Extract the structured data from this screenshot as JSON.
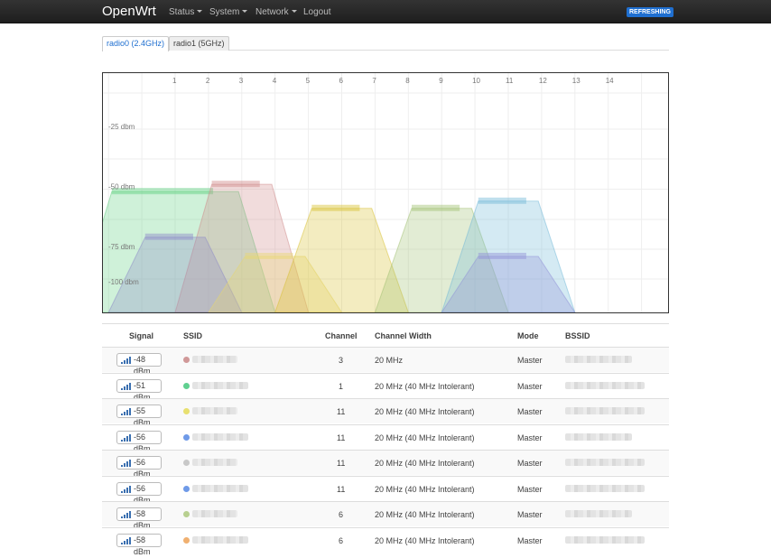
{
  "navbar": {
    "brand": "OpenWrt",
    "menu": [
      {
        "label": "Status",
        "dropdown": true
      },
      {
        "label": "System",
        "dropdown": true
      },
      {
        "label": "Network",
        "dropdown": true
      },
      {
        "label": "Logout",
        "dropdown": false
      }
    ],
    "refresh_badge": "REFRESHING"
  },
  "tabs": [
    {
      "label": "radio0 (2.4GHz)",
      "active": true
    },
    {
      "label": "radio1 (5GHz)",
      "active": false
    }
  ],
  "channel_chart": {
    "channels": [
      "1",
      "2",
      "3",
      "4",
      "5",
      "6",
      "7",
      "8",
      "9",
      "10",
      "11",
      "12",
      "13",
      "14"
    ],
    "dbm_labels": [
      "-25 dbm",
      "-50 dbm",
      "-75 dbm",
      "-100 dbm"
    ],
    "networks": [
      {
        "channel": 1,
        "width_mhz": 40,
        "signal": -51,
        "color": "#60d080"
      },
      {
        "channel": 3,
        "width_mhz": 20,
        "signal": -48,
        "color": "#d08a8a"
      },
      {
        "channel": 1,
        "width_mhz": 20,
        "signal": -70,
        "color": "#8c88c8"
      },
      {
        "channel": 4,
        "width_mhz": 20,
        "signal": -78,
        "color": "#e8d870"
      },
      {
        "channel": 6,
        "width_mhz": 20,
        "signal": -58,
        "color": "#d8c030"
      },
      {
        "channel": 9,
        "width_mhz": 20,
        "signal": -58,
        "color": "#a0c070"
      },
      {
        "channel": 11,
        "width_mhz": 20,
        "signal": -55,
        "color": "#70b8d8"
      },
      {
        "channel": 11,
        "width_mhz": 20,
        "signal": -78,
        "color": "#9090d8"
      }
    ]
  },
  "table": {
    "headers": {
      "signal": "Signal",
      "ssid": "SSID",
      "channel": "Channel",
      "width": "Channel Width",
      "mode": "Mode",
      "bssid": "BSSID"
    },
    "rows": [
      {
        "signal": "-48 dBm",
        "color": "#d09898",
        "channel": "3",
        "width": "20 MHz",
        "mode": "Master"
      },
      {
        "signal": "-51 dBm",
        "color": "#60d090",
        "channel": "1",
        "width": "20 MHz (40 MHz Intolerant)",
        "mode": "Master"
      },
      {
        "signal": "-55 dBm",
        "color": "#e8e070",
        "channel": "11",
        "width": "20 MHz (40 MHz Intolerant)",
        "mode": "Master"
      },
      {
        "signal": "-56 dBm",
        "color": "#6f9ae8",
        "channel": "11",
        "width": "20 MHz (40 MHz Intolerant)",
        "mode": "Master"
      },
      {
        "signal": "-56 dBm",
        "color": "#c8c8c8",
        "channel": "11",
        "width": "20 MHz (40 MHz Intolerant)",
        "mode": "Master"
      },
      {
        "signal": "-56 dBm",
        "color": "#6f9ae8",
        "channel": "11",
        "width": "20 MHz (40 MHz Intolerant)",
        "mode": "Master"
      },
      {
        "signal": "-58 dBm",
        "color": "#b8d090",
        "channel": "6",
        "width": "20 MHz (40 MHz Intolerant)",
        "mode": "Master"
      },
      {
        "signal": "-58 dBm",
        "color": "#f0b070",
        "channel": "6",
        "width": "20 MHz (40 MHz Intolerant)",
        "mode": "Master"
      }
    ]
  }
}
